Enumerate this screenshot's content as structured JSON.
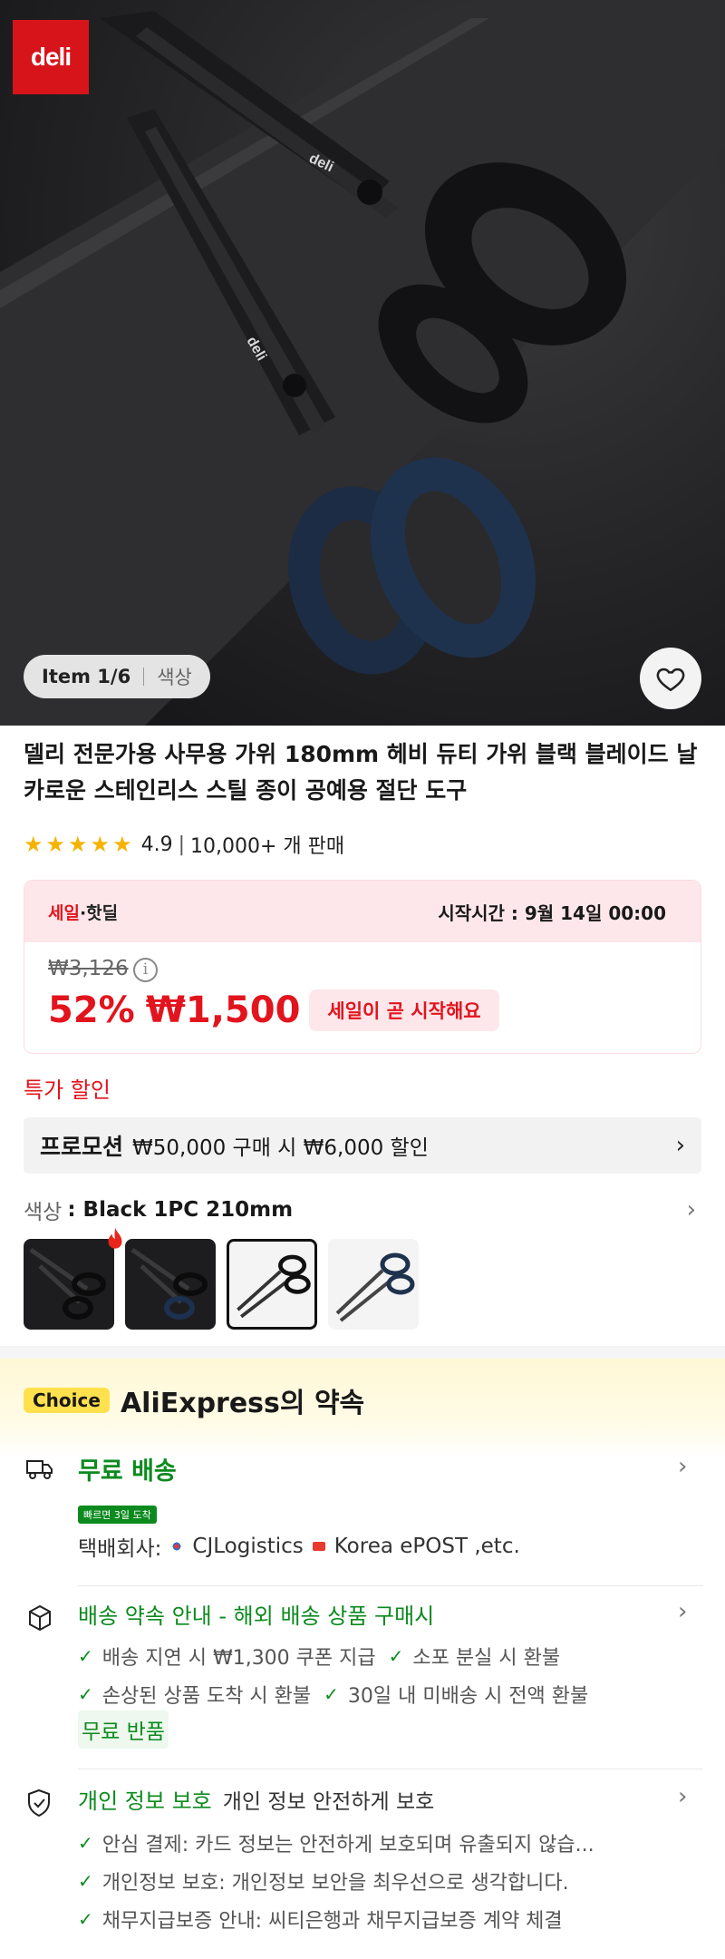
{
  "brand": {
    "logo_text": "deli"
  },
  "gallery": {
    "item_label": "Item 1/6",
    "color_label": "색상"
  },
  "product": {
    "title": "델리 전문가용 사무용 가위 180mm 헤비 듀티 가위 블랙 블레이드 날카로운 스테인리스 스틸 종이 공예용 절단 도구",
    "rating": "4.9",
    "rating_value": 4.9,
    "sold": "10,000+ 개 판매"
  },
  "sale": {
    "tag_red": "세일",
    "tag_rest": "·핫딜",
    "start_time": "시작시간 : 9월 14일 00:00",
    "original_price": "₩3,126",
    "discount": "52%",
    "price": "₩1,500",
    "soon_label": "세일이 곧 시작해요"
  },
  "special_label": "특가 할인",
  "promotion": {
    "label": "프로모션",
    "text": "₩50,000 구매 시 ₩6,000 할인"
  },
  "color": {
    "key": "색상",
    "value": ": Black 1PC 210mm",
    "options": [
      "dark-black",
      "dark-blue",
      "black-selected",
      "blue-light"
    ]
  },
  "choice": {
    "badge": "Choice",
    "title": "AliExpress의 약속",
    "shipping": {
      "title": "무료 배송",
      "badge": "빠르면 3일 도착",
      "carriers_prefix": "택배회사:",
      "carrier1": "CJLogistics",
      "carrier2": "Korea ePOST ,etc."
    },
    "delivery": {
      "title": "배송 약속 안내 - 해외 배송 상품 구매시",
      "items": [
        "배송 지연 시 ₩1,300 쿠폰 지급",
        "소포 분실 시 환불",
        "손상된 상품 도착 시 환불",
        "30일 내 미배송 시 전액 환불"
      ],
      "free_return": "무료 반품"
    },
    "privacy": {
      "title": "개인 정보 보호",
      "subtitle": "개인 정보 안전하게 보호",
      "items": [
        "안심 결제: 카드 정보는 안전하게 보호되며 유출되지 않습...",
        "개인정보 보호: 개인정보 보안을 최우선으로 생각합니다.",
        "채무지급보증 안내: 씨티은행과 채무지급보증 계약 체결"
      ]
    }
  },
  "colors": {
    "accent_red": "#e2141d",
    "green": "#0c8a1e",
    "choice_yellow": "#ffe14d"
  }
}
